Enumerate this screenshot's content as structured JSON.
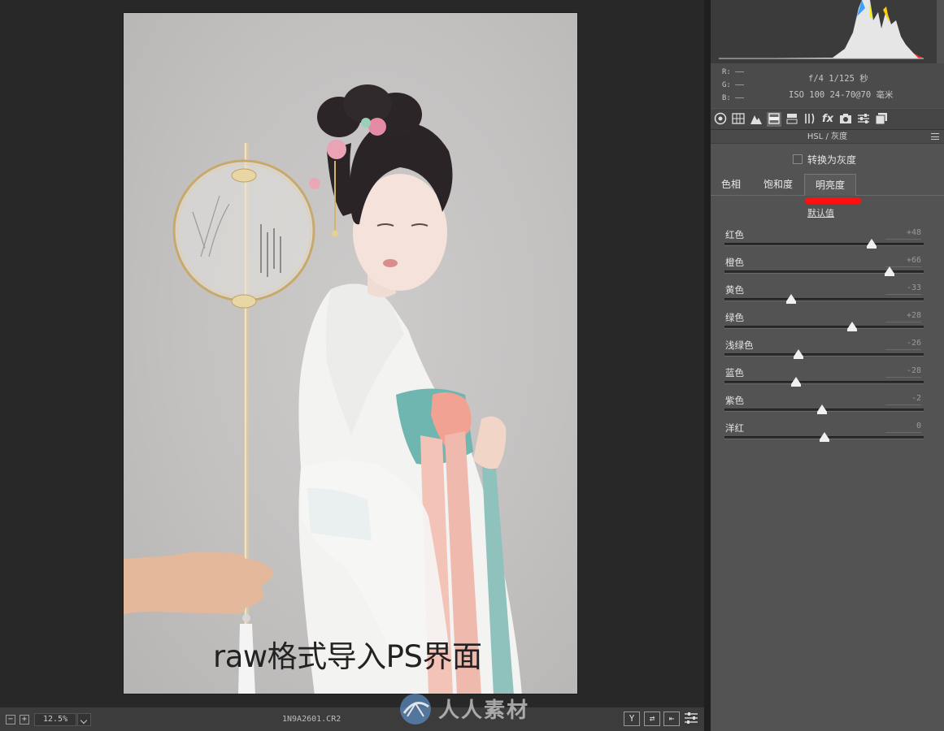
{
  "preview": {
    "caption": "raw格式导入PS界面"
  },
  "status_bar": {
    "minus": "−",
    "plus": "+",
    "zoom": "12.5%",
    "filename": "1N9A2601.CR2",
    "icon_y": "Y",
    "icon_swap": "⇄",
    "icon_back": "⇤"
  },
  "watermark": {
    "text": "人人素材"
  },
  "info": {
    "r": "R:  ——",
    "g": "G:  ——",
    "b": "B:  ——",
    "camera_line1": "f/4   1/125 秒",
    "camera_line2": "ISO 100   24-70@70 毫米"
  },
  "toolbar": {
    "icons": [
      "aperture-icon",
      "grid-icon",
      "mountain-icon",
      "hsl-icon",
      "split-tone-icon",
      "lens-icon",
      "fx-icon",
      "camera-icon",
      "presets-icon",
      "snapshots-icon"
    ]
  },
  "panel": {
    "title": "HSL / 灰度",
    "convert_gray_label": "转换为灰度",
    "convert_gray_checked": false,
    "tabs": [
      "色相",
      "饱和度",
      "明亮度"
    ],
    "active_tab": "明亮度",
    "default_link": "默认值",
    "annotation_color": "#ff1010",
    "sliders": [
      {
        "label": "红色",
        "value": "+48",
        "num": 48
      },
      {
        "label": "橙色",
        "value": "+66",
        "num": 66
      },
      {
        "label": "黄色",
        "value": "-33",
        "num": -33
      },
      {
        "label": "绿色",
        "value": "+28",
        "num": 28
      },
      {
        "label": "浅绿色",
        "value": "-26",
        "num": -26
      },
      {
        "label": "蓝色",
        "value": "-28",
        "num": -28
      },
      {
        "label": "紫色",
        "value": "-2",
        "num": -2
      },
      {
        "label": "洋红",
        "value": "0",
        "num": 0
      }
    ]
  }
}
